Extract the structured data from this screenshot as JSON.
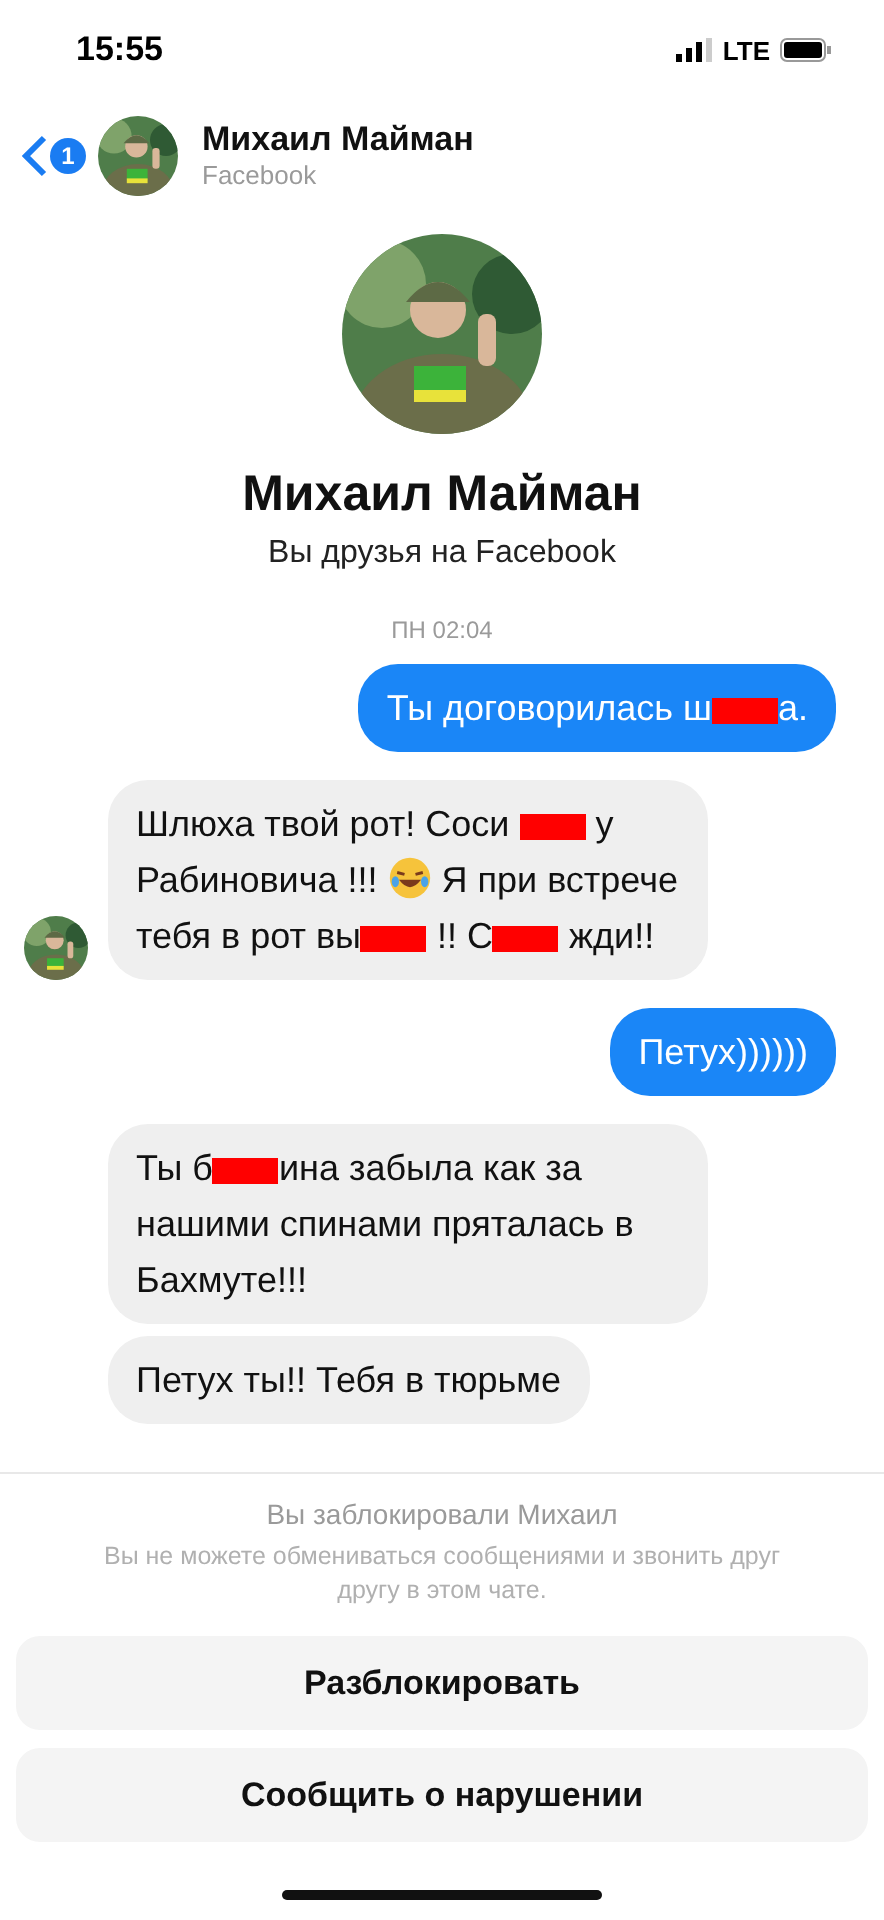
{
  "status_bar": {
    "time": "15:55",
    "network": "LTE"
  },
  "header": {
    "back_badge": "1",
    "name": "Михаил Майман",
    "subtitle": "Facebook"
  },
  "profile": {
    "name": "Михаил Майман",
    "subtitle": "Вы друзья на Facebook"
  },
  "timestamp": "ПН 02:04",
  "messages": [
    {
      "kind": "sent",
      "parts": [
        {
          "kind": "text",
          "text": "Ты договорилась ш"
        },
        {
          "kind": "redaction"
        },
        {
          "kind": "text",
          "text": "а."
        }
      ]
    },
    {
      "kind": "received",
      "show_avatar": true,
      "parts": [
        {
          "kind": "text",
          "text": "Шлюха твой рот! Соси "
        },
        {
          "kind": "redaction"
        },
        {
          "kind": "text",
          "text": " у Рабиновича !!! "
        },
        {
          "kind": "emoji"
        },
        {
          "kind": "text",
          "text": " Я при встрече тебя в рот вы"
        },
        {
          "kind": "redaction"
        },
        {
          "kind": "text",
          "text": " !! С"
        },
        {
          "kind": "redaction"
        },
        {
          "kind": "text",
          "text": " жди!!"
        }
      ]
    },
    {
      "kind": "sent",
      "parts": [
        {
          "kind": "text",
          "text": "Петух))))))"
        }
      ]
    },
    {
      "kind": "received",
      "show_avatar": false,
      "parts": [
        {
          "kind": "text",
          "text": "Ты б"
        },
        {
          "kind": "redaction"
        },
        {
          "kind": "text",
          "text": "ина забыла как за нашими спинами пряталась в Бахмуте!!!"
        }
      ]
    },
    {
      "kind": "received",
      "show_avatar": false,
      "parts": [
        {
          "kind": "text",
          "text": "Петух ты!! Тебя в тюрьме"
        }
      ]
    }
  ],
  "blocked_panel": {
    "title": "Вы заблокировали Михаил",
    "description": "Вы не можете обмениваться сообщениями и звонить друг другу в этом чате.",
    "buttons": [
      "Разблокировать",
      "Сообщить о нарушении"
    ]
  }
}
